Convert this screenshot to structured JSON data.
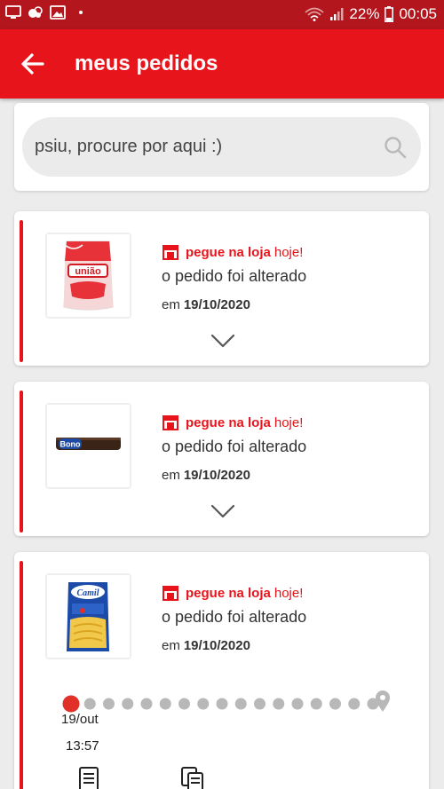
{
  "status_bar": {
    "battery": "22%",
    "time": "00:05",
    "icons": [
      "screen-cast-icon",
      "notification-icon",
      "image-icon",
      "wifi-icon",
      "signal-icon",
      "battery-icon"
    ]
  },
  "app_bar": {
    "title": "meus pedidos",
    "back_icon": "arrow-left-icon"
  },
  "search": {
    "placeholder": "psiu, procure por aqui :)",
    "icon": "search-icon"
  },
  "orders": [
    {
      "product": "união refinado sugar",
      "store_label": "pegue na loja",
      "store_when": "hoje!",
      "status": "o pedido foi alterado",
      "date_prefix": "em",
      "date": "19/10/2020",
      "expanded": false
    },
    {
      "product": "bono biscuit",
      "store_label": "pegue na loja",
      "store_when": "hoje!",
      "status": "o pedido foi alterado",
      "date_prefix": "em",
      "date": "19/10/2020",
      "expanded": false
    },
    {
      "product": "camil pasta",
      "store_label": "pegue na loja",
      "store_when": "hoje!",
      "status": "o pedido foi alterado",
      "date_prefix": "em",
      "date": "19/10/2020",
      "expanded": true,
      "timeline": {
        "day": "19/out",
        "time": "13:57",
        "steps": 17,
        "current_step": 1
      }
    }
  ],
  "colors": {
    "primary": "#e8141c",
    "status_bar": "#b3161c",
    "background": "#ececec",
    "timeline_dot": "#b8b8b8",
    "timeline_active": "#e03028"
  }
}
